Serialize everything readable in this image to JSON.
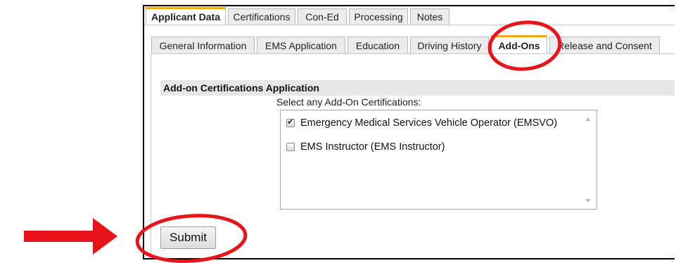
{
  "main_tabs": [
    {
      "label": "Applicant Data",
      "active": true
    },
    {
      "label": "Certifications",
      "active": false
    },
    {
      "label": "Con-Ed",
      "active": false
    },
    {
      "label": "Processing",
      "active": false
    },
    {
      "label": "Notes",
      "active": false
    }
  ],
  "sub_tabs": [
    {
      "label": "General Information",
      "active": false
    },
    {
      "label": "EMS Application",
      "active": false
    },
    {
      "label": "Education",
      "active": false
    },
    {
      "label": "Driving History",
      "active": false
    },
    {
      "label": "Add-Ons",
      "active": true
    },
    {
      "label": "Release and Consent",
      "active": false
    }
  ],
  "section": {
    "title": "Add-on Certifications Application",
    "prompt": "Select any Add-On Certifications:"
  },
  "certifications": [
    {
      "label": "Emergency Medical Services Vehicle Operator (EMSVO)",
      "checked": true
    },
    {
      "label": "EMS Instructor (EMS Instructor)",
      "checked": false
    }
  ],
  "submit_label": "Submit",
  "colors": {
    "active_tab_accent": "#f2a81d",
    "annotation_red": "#e8141a"
  },
  "annotations": [
    "red-circle-add-ons-tab",
    "red-circle-submit-button",
    "red-arrow-pointing-submit"
  ]
}
